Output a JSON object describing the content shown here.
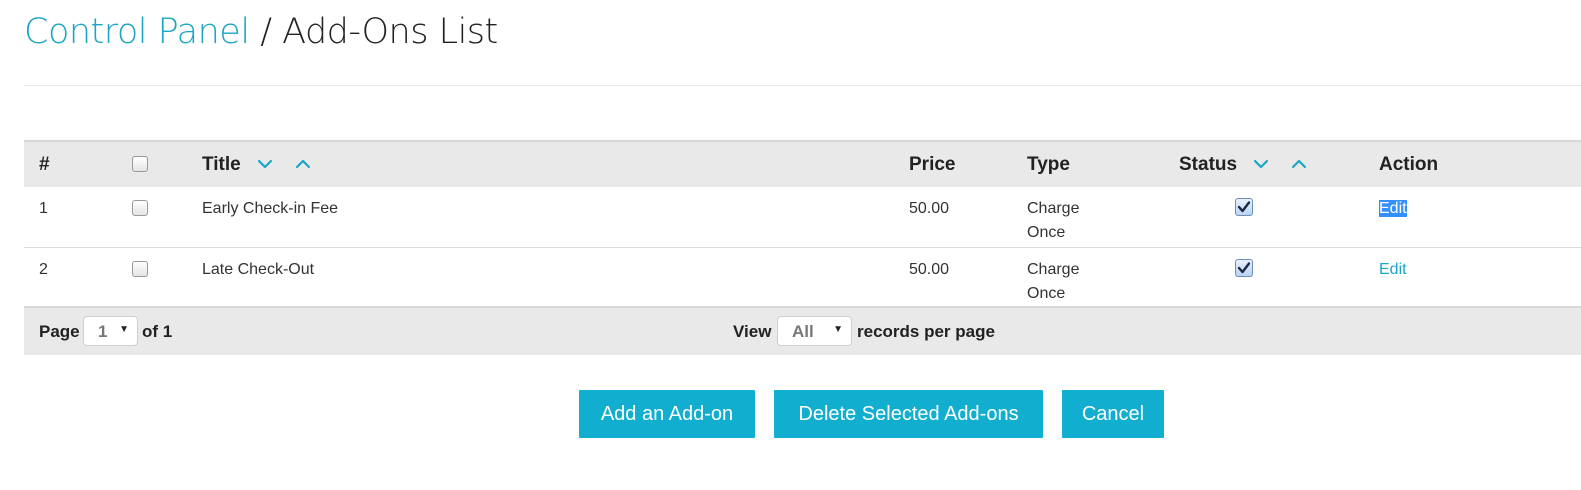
{
  "header": {
    "breadcrumb_link": "Control Panel",
    "separator": " / ",
    "current_page": "Add-Ons List"
  },
  "table": {
    "columns": {
      "num": "#",
      "title": "Title",
      "price": "Price",
      "type": "Type",
      "status": "Status",
      "action": "Action"
    },
    "rows": [
      {
        "num": "1",
        "title": "Early Check-in Fee",
        "price": "50.00",
        "type_line1": "Charge",
        "type_line2": "Once",
        "status_checked": true,
        "action": "Edit",
        "selected": false
      },
      {
        "num": "2",
        "title": "Late Check-Out",
        "price": "50.00",
        "type_line1": "Charge",
        "type_line2": "Once",
        "status_checked": true,
        "action": "Edit",
        "selected": false
      }
    ]
  },
  "pagination": {
    "page_label": "Page",
    "page_value": "1",
    "of_label": "of 1",
    "view_label": "View",
    "view_value": "All",
    "records_label": "records per page"
  },
  "buttons": {
    "add": "Add an Add-on",
    "delete": "Delete Selected Add-ons",
    "cancel": "Cancel"
  },
  "colors": {
    "accent": "#12aed0",
    "link": "#1aa6c4",
    "header_bg": "#e9e9e9",
    "selection": "#3390ff"
  },
  "icons": {
    "sort_desc": "chevron-down-icon",
    "sort_asc": "chevron-up-icon",
    "status": "checkbox-checked-icon",
    "dropdown": "dropdown-arrow-icon"
  }
}
